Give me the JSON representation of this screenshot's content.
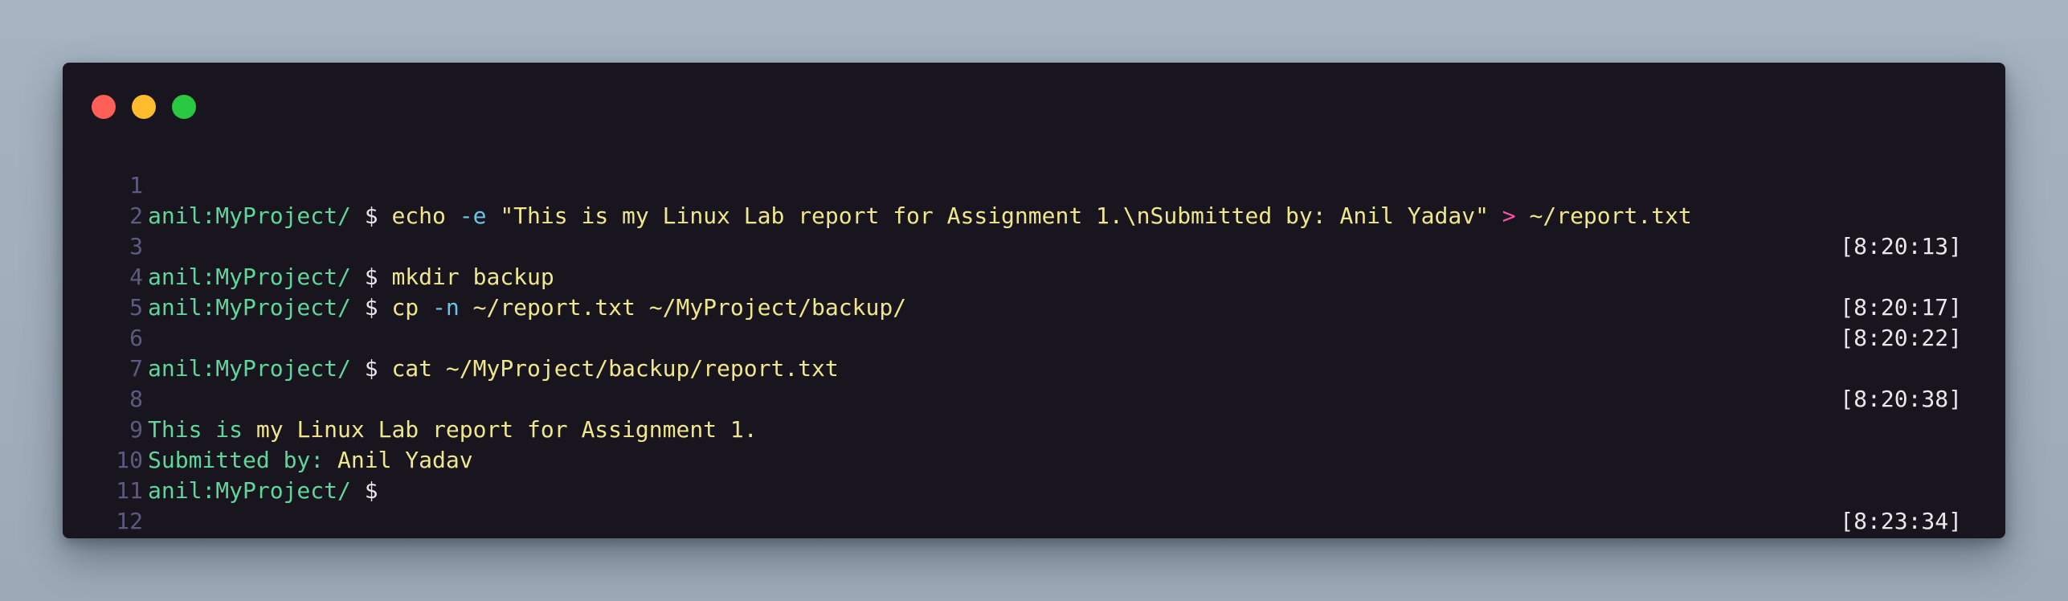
{
  "window": {
    "controls": [
      "close-dot",
      "minimize-dot",
      "maximize-dot"
    ],
    "colors": {
      "background": "#18151f",
      "close": "#ff5f57",
      "minimize": "#febc2e",
      "maximize": "#28c840",
      "prompt": "#5fd69a",
      "command": "#f0e68c",
      "flag": "#6cc3e8",
      "redirect": "#ff4fa8",
      "line_number": "#5c5a82",
      "timestamp": "#e8e8ea"
    }
  },
  "terminal": {
    "prompt": "anil:MyProject/",
    "dollar": "$",
    "line_numbers": [
      "1",
      "2",
      "3",
      "4",
      "5",
      "6",
      "7",
      "8",
      "9",
      "10",
      "11",
      "12"
    ],
    "line1": {
      "cmd": "echo",
      "flag": "-e",
      "arg": "\"This is my Linux Lab report for Assignment 1.\\nSubmitted by: Anil Yadav\"",
      "redirect": ">",
      "target": "~/report.txt",
      "time": "[8:20:13]"
    },
    "line3": {
      "cmd": "mkdir backup",
      "time": "[8:20:17]"
    },
    "line4": {
      "cmd": "cp",
      "flag": "-n",
      "args": "~/report.txt ~/MyProject/backup/",
      "time": "[8:20:22]"
    },
    "line6": {
      "cmd": "cat ~/MyProject/backup/report.txt",
      "time": "[8:20:38]"
    },
    "line8": {
      "w1": "This",
      "w2": "is",
      "rest": "my Linux Lab report for Assignment 1."
    },
    "line9": {
      "w1": "Submitted",
      "w2": "by:",
      "rest": "Anil Yadav"
    },
    "line10": {
      "time": "[8:23:34]"
    }
  }
}
